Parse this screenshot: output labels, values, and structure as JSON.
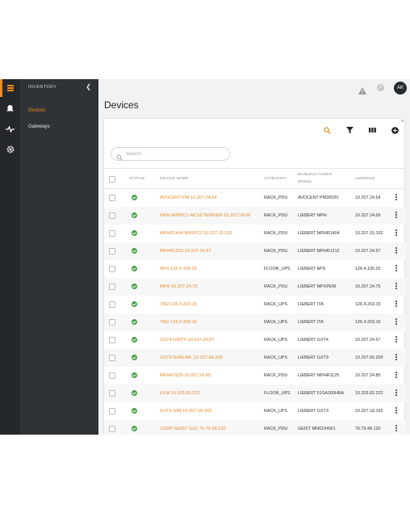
{
  "sidebar": {
    "title": "INVENTORY",
    "collapse_icon": "chevron-left-icon",
    "items": [
      {
        "label": "Devices"
      },
      {
        "label": "Gateways"
      }
    ]
  },
  "rail": {
    "icons": [
      "inventory-icon",
      "alarms-icon",
      "activity-icon",
      "settings-icon"
    ]
  },
  "header": {
    "avatar": "AK",
    "icons": [
      "warning-icon",
      "close-icon"
    ]
  },
  "page": {
    "title": "Devices"
  },
  "toolbar": {
    "icons": [
      "search-icon",
      "filter-icon",
      "columns-icon",
      "add-icon"
    ]
  },
  "search": {
    "placeholder": "Search",
    "value": ""
  },
  "table": {
    "columns": {
      "status": "STATUS",
      "device_name": "DEVICE NAME",
      "category": "CATEGORY",
      "model_line1": "MANUFACTURER",
      "model_line2": "MODEL",
      "address": "ADDRESS"
    },
    "rows": [
      {
        "name": "AVOCENT PM 10.207.24.54",
        "category": "RACK_PDU",
        "model": "AVOCENT PM3003V",
        "address": "10.207.24.54"
      },
      {
        "name": "MPH W/RPC1-NCV27NXKH30-10.207.24.69",
        "category": "RACK_PDU",
        "model": "LIEBERT MPH",
        "address": "10.207.24.69"
      },
      {
        "name": "MPHR1404 W/RPC2 10.207.15.152",
        "category": "RACK_PDU",
        "model": "LIEBERT MPHR1404",
        "address": "10.207.15.152"
      },
      {
        "name": "MPHR1212-10.207.24.57",
        "category": "RACK_PDU",
        "model": "LIEBERT MPHR1212",
        "address": "10.207.24.57"
      },
      {
        "name": "APS-126.4.105.25",
        "category": "FLOOR_UPS",
        "model": "LIEBERT APS",
        "address": "126.4.105.25"
      },
      {
        "name": "MPX-10.207.24.75",
        "category": "RACK_PDU",
        "model": "LIEBERT MPXPEM",
        "address": "10.207.24.75"
      },
      {
        "name": "ITA2-126.4.203.15",
        "category": "RACK_UPS",
        "model": "LIEBERT ITA",
        "address": "126.4.203.15"
      },
      {
        "name": "ITA2-126.4.203.16",
        "category": "RACK_UPS",
        "model": "LIEBERT ITA",
        "address": "126.4.203.16"
      },
      {
        "name": "GXT4-UNITY-10.207.24.67",
        "category": "RACK_UPS",
        "model": "LIEBERT GXT4",
        "address": "10.207.24.67"
      },
      {
        "name": "GXT3-SUNLAB_10.207.66.209",
        "category": "RACK_UPS",
        "model": "LIEBERT GXT3",
        "address": "10.207.66.209"
      },
      {
        "name": "MPHR1125-10.207.24.85",
        "category": "RACK_PDU",
        "model": "LIEBERT MPHR1125",
        "address": "10.207.24.85"
      },
      {
        "name": "EXM 10.203.82.222",
        "category": "FLOOR_UPS",
        "model": "LIEBERT 51SA200HBA",
        "address": "10.203.82.222"
      },
      {
        "name": "GXT3-SIM-10.207.18.165",
        "category": "RACK_UPS",
        "model": "LIEBERT GXT3",
        "address": "10.207.18.165"
      },
      {
        "name": "CGRP GEIST GU1 76.79.48.120",
        "category": "RACK_PDU",
        "model": "GEIST MN02X4W1",
        "address": "76.79.48.120"
      }
    ]
  },
  "colors": {
    "accent": "#ef8a1b",
    "ok": "#3fa13f",
    "rail": "#24272b",
    "sidebar": "#2f3338"
  }
}
